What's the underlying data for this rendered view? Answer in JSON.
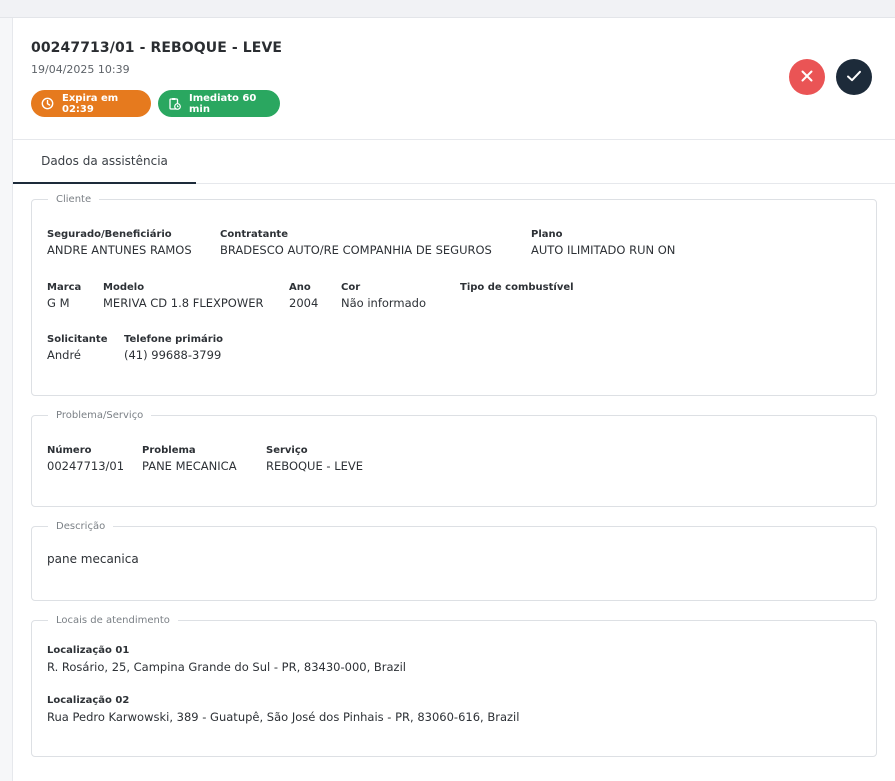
{
  "header": {
    "title": "00247713/01 - REBOQUE - LEVE",
    "datetime": "19/04/2025 10:39",
    "badge_expira": "Expira em 02:39",
    "badge_imediato": "Imediato 60 min"
  },
  "tabs": [
    {
      "label": "Dados da assistência",
      "active": true
    }
  ],
  "cliente": {
    "legend": "Cliente",
    "segurado_label": "Segurado/Beneficiário",
    "segurado_value": "ANDRE ANTUNES RAMOS",
    "contratante_label": "Contratante",
    "contratante_value": "BRADESCO AUTO/RE COMPANHIA DE SEGUROS",
    "plano_label": "Plano",
    "plano_value": "AUTO ILIMITADO RUN ON",
    "marca_label": "Marca",
    "marca_value": "G M",
    "modelo_label": "Modelo",
    "modelo_value": "MERIVA CD 1.8 FLEXPOWER",
    "ano_label": "Ano",
    "ano_value": "2004",
    "cor_label": "Cor",
    "cor_value": "Não informado",
    "combustivel_label": "Tipo de combustível",
    "solicitante_label": "Solicitante",
    "solicitante_value": "André",
    "telefone_label": "Telefone primário",
    "telefone_value": "(41) 99688-3799"
  },
  "problema": {
    "legend": "Problema/Serviço",
    "numero_label": "Número",
    "numero_value": "00247713/01",
    "problema_label": "Problema",
    "problema_value": "PANE MECANICA",
    "servico_label": "Serviço",
    "servico_value": "REBOQUE - LEVE"
  },
  "descricao": {
    "legend": "Descrição",
    "text": "pane mecanica"
  },
  "locais": {
    "legend": "Locais de atendimento",
    "loc1_label": "Localização 01",
    "loc1_value": "R. Rosário, 25, Campina Grande do Sul - PR, 83430-000, Brazil",
    "loc2_label": "Localização 02",
    "loc2_value": "Rua Pedro Karwowski, 389 - Guatupê, São José dos Pinhais - PR, 83060-616, Brazil"
  },
  "colors": {
    "accent_dark": "#1d2b3a",
    "cancel_red": "#ea5455",
    "badge_orange": "#e67a1e",
    "badge_green": "#2aa760"
  },
  "icons": {
    "cancel": "close-icon",
    "confirm": "check-icon",
    "expira": "clock-icon",
    "imediato": "clipboard-clock-icon"
  }
}
